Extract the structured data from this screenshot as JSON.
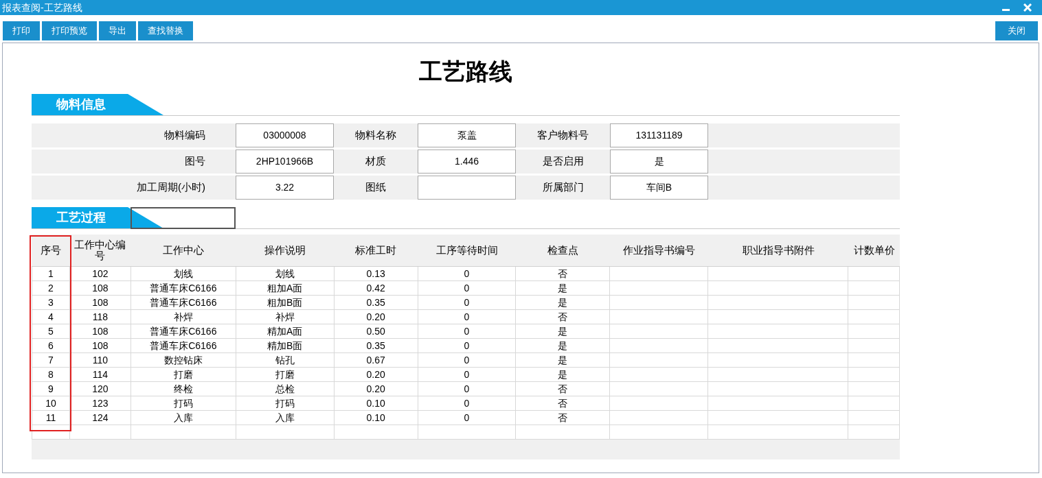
{
  "window": {
    "title": "报表查阅-工艺路线"
  },
  "toolbar": [
    "打印",
    "打印预览",
    "导出",
    "查找替换"
  ],
  "close_button": "关闭",
  "report": {
    "title": "工艺路线",
    "material_section": {
      "heading": "物料信息",
      "rows": [
        [
          {
            "label": "物料编码",
            "value": "03000008"
          },
          {
            "label": "物料名称",
            "value": "泵盖"
          },
          {
            "label": "客户物料号",
            "value": "131131189"
          }
        ],
        [
          {
            "label": "图号",
            "value": "2HP101966B"
          },
          {
            "label": "材质",
            "value": "1.446"
          },
          {
            "label": "是否启用",
            "value": "是"
          }
        ],
        [
          {
            "label": "加工周期(小时)",
            "value": "3.22"
          },
          {
            "label": "图纸"
          },
          {
            "label": "所属部门",
            "value": "车间B"
          }
        ]
      ]
    },
    "process_section": {
      "heading": "工艺过程",
      "columns": [
        {
          "label": "序号",
          "highlighted": true
        },
        {
          "label": "工作中心编号"
        },
        {
          "label": "工作中心"
        },
        {
          "label": "操作说明"
        },
        {
          "label": "标准工时"
        },
        {
          "label": "工序等待时间"
        },
        {
          "label": "检查点"
        },
        {
          "label": "作业指导书编号"
        },
        {
          "label": "职业指导书附件"
        },
        {
          "label": "计数单价"
        }
      ],
      "rows": [
        {
          "seq": "1",
          "center_code": "102",
          "center": "划线",
          "operation": "划线",
          "std_time": "0.13",
          "wait_time": "0",
          "checkpoint": "否"
        },
        {
          "seq": "2",
          "center_code": "108",
          "center": "普通车床C6166",
          "operation": "粗加A面",
          "std_time": "0.42",
          "wait_time": "0",
          "checkpoint": "是"
        },
        {
          "seq": "3",
          "center_code": "108",
          "center": "普通车床C6166",
          "operation": "粗加B面",
          "std_time": "0.35",
          "wait_time": "0",
          "checkpoint": "是"
        },
        {
          "seq": "4",
          "center_code": "118",
          "center": "补焊",
          "operation": "补焊",
          "std_time": "0.20",
          "wait_time": "0",
          "checkpoint": "否"
        },
        {
          "seq": "5",
          "center_code": "108",
          "center": "普通车床C6166",
          "operation": "精加A面",
          "std_time": "0.50",
          "wait_time": "0",
          "checkpoint": "是"
        },
        {
          "seq": "6",
          "center_code": "108",
          "center": "普通车床C6166",
          "operation": "精加B面",
          "std_time": "0.35",
          "wait_time": "0",
          "checkpoint": "是"
        },
        {
          "seq": "7",
          "center_code": "110",
          "center": "数控钻床",
          "operation": "钻孔",
          "std_time": "0.67",
          "wait_time": "0",
          "checkpoint": "是"
        },
        {
          "seq": "8",
          "center_code": "114",
          "center": "打磨",
          "operation": "打磨",
          "std_time": "0.20",
          "wait_time": "0",
          "checkpoint": "是"
        },
        {
          "seq": "9",
          "center_code": "120",
          "center": "终检",
          "operation": "总检",
          "std_time": "0.20",
          "wait_time": "0",
          "checkpoint": "否"
        },
        {
          "seq": "10",
          "center_code": "123",
          "center": "打码",
          "operation": "打码",
          "std_time": "0.10",
          "wait_time": "0",
          "checkpoint": "否"
        },
        {
          "seq": "11",
          "center_code": "124",
          "center": "入库",
          "operation": "入库",
          "std_time": "0.10",
          "wait_time": "0",
          "checkpoint": "否"
        }
      ]
    }
  }
}
